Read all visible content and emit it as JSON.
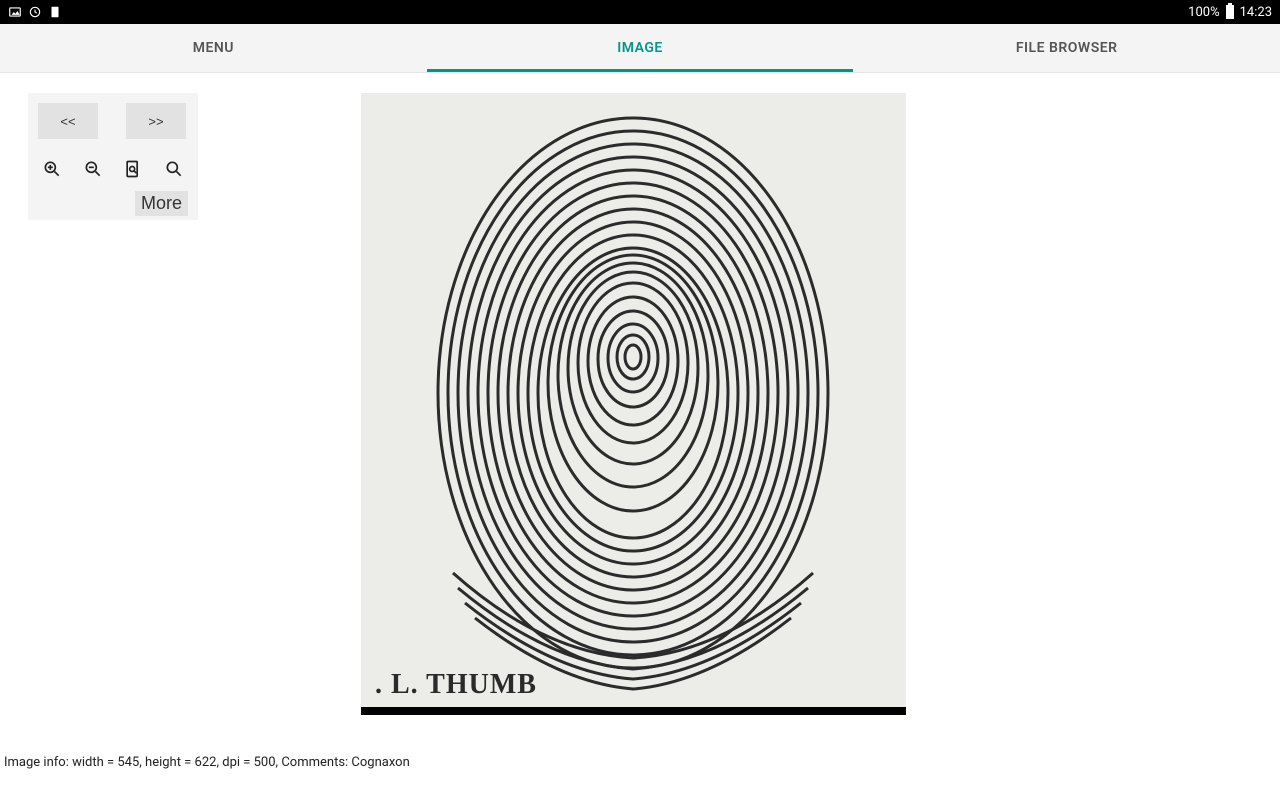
{
  "statusbar": {
    "battery_text": "100%",
    "clock": "14:23"
  },
  "tabs": {
    "menu": "MENU",
    "image": "IMAGE",
    "file_browser": "FILE BROWSER"
  },
  "toolbox": {
    "prev": "<<",
    "next": ">>",
    "more": "More"
  },
  "image": {
    "caption": ". L. THUMB"
  },
  "footer": {
    "info": "Image info: width = 545, height = 622, dpi = 500, Comments: Cognaxon"
  }
}
